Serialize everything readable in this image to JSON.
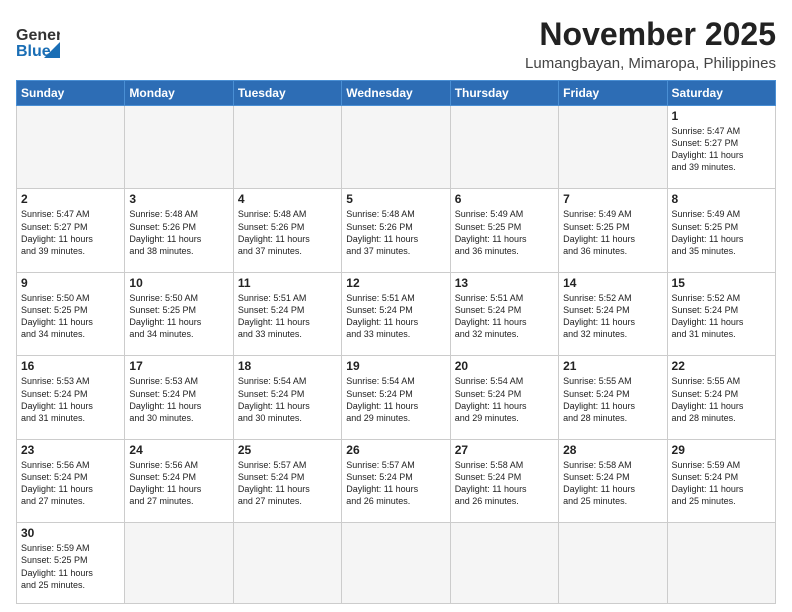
{
  "logo": {
    "text_general": "General",
    "text_blue": "Blue"
  },
  "header": {
    "month_title": "November 2025",
    "location": "Lumangbayan, Mimaropa, Philippines"
  },
  "weekdays": [
    "Sunday",
    "Monday",
    "Tuesday",
    "Wednesday",
    "Thursday",
    "Friday",
    "Saturday"
  ],
  "weeks": [
    [
      {
        "day": "",
        "info": ""
      },
      {
        "day": "",
        "info": ""
      },
      {
        "day": "",
        "info": ""
      },
      {
        "day": "",
        "info": ""
      },
      {
        "day": "",
        "info": ""
      },
      {
        "day": "",
        "info": ""
      },
      {
        "day": "1",
        "info": "Sunrise: 5:47 AM\nSunset: 5:27 PM\nDaylight: 11 hours\nand 39 minutes."
      }
    ],
    [
      {
        "day": "2",
        "info": "Sunrise: 5:47 AM\nSunset: 5:27 PM\nDaylight: 11 hours\nand 39 minutes."
      },
      {
        "day": "3",
        "info": "Sunrise: 5:48 AM\nSunset: 5:26 PM\nDaylight: 11 hours\nand 38 minutes."
      },
      {
        "day": "4",
        "info": "Sunrise: 5:48 AM\nSunset: 5:26 PM\nDaylight: 11 hours\nand 37 minutes."
      },
      {
        "day": "5",
        "info": "Sunrise: 5:48 AM\nSunset: 5:26 PM\nDaylight: 11 hours\nand 37 minutes."
      },
      {
        "day": "6",
        "info": "Sunrise: 5:49 AM\nSunset: 5:25 PM\nDaylight: 11 hours\nand 36 minutes."
      },
      {
        "day": "7",
        "info": "Sunrise: 5:49 AM\nSunset: 5:25 PM\nDaylight: 11 hours\nand 36 minutes."
      },
      {
        "day": "8",
        "info": "Sunrise: 5:49 AM\nSunset: 5:25 PM\nDaylight: 11 hours\nand 35 minutes."
      }
    ],
    [
      {
        "day": "9",
        "info": "Sunrise: 5:50 AM\nSunset: 5:25 PM\nDaylight: 11 hours\nand 34 minutes."
      },
      {
        "day": "10",
        "info": "Sunrise: 5:50 AM\nSunset: 5:25 PM\nDaylight: 11 hours\nand 34 minutes."
      },
      {
        "day": "11",
        "info": "Sunrise: 5:51 AM\nSunset: 5:24 PM\nDaylight: 11 hours\nand 33 minutes."
      },
      {
        "day": "12",
        "info": "Sunrise: 5:51 AM\nSunset: 5:24 PM\nDaylight: 11 hours\nand 33 minutes."
      },
      {
        "day": "13",
        "info": "Sunrise: 5:51 AM\nSunset: 5:24 PM\nDaylight: 11 hours\nand 32 minutes."
      },
      {
        "day": "14",
        "info": "Sunrise: 5:52 AM\nSunset: 5:24 PM\nDaylight: 11 hours\nand 32 minutes."
      },
      {
        "day": "15",
        "info": "Sunrise: 5:52 AM\nSunset: 5:24 PM\nDaylight: 11 hours\nand 31 minutes."
      }
    ],
    [
      {
        "day": "16",
        "info": "Sunrise: 5:53 AM\nSunset: 5:24 PM\nDaylight: 11 hours\nand 31 minutes."
      },
      {
        "day": "17",
        "info": "Sunrise: 5:53 AM\nSunset: 5:24 PM\nDaylight: 11 hours\nand 30 minutes."
      },
      {
        "day": "18",
        "info": "Sunrise: 5:54 AM\nSunset: 5:24 PM\nDaylight: 11 hours\nand 30 minutes."
      },
      {
        "day": "19",
        "info": "Sunrise: 5:54 AM\nSunset: 5:24 PM\nDaylight: 11 hours\nand 29 minutes."
      },
      {
        "day": "20",
        "info": "Sunrise: 5:54 AM\nSunset: 5:24 PM\nDaylight: 11 hours\nand 29 minutes."
      },
      {
        "day": "21",
        "info": "Sunrise: 5:55 AM\nSunset: 5:24 PM\nDaylight: 11 hours\nand 28 minutes."
      },
      {
        "day": "22",
        "info": "Sunrise: 5:55 AM\nSunset: 5:24 PM\nDaylight: 11 hours\nand 28 minutes."
      }
    ],
    [
      {
        "day": "23",
        "info": "Sunrise: 5:56 AM\nSunset: 5:24 PM\nDaylight: 11 hours\nand 27 minutes."
      },
      {
        "day": "24",
        "info": "Sunrise: 5:56 AM\nSunset: 5:24 PM\nDaylight: 11 hours\nand 27 minutes."
      },
      {
        "day": "25",
        "info": "Sunrise: 5:57 AM\nSunset: 5:24 PM\nDaylight: 11 hours\nand 27 minutes."
      },
      {
        "day": "26",
        "info": "Sunrise: 5:57 AM\nSunset: 5:24 PM\nDaylight: 11 hours\nand 26 minutes."
      },
      {
        "day": "27",
        "info": "Sunrise: 5:58 AM\nSunset: 5:24 PM\nDaylight: 11 hours\nand 26 minutes."
      },
      {
        "day": "28",
        "info": "Sunrise: 5:58 AM\nSunset: 5:24 PM\nDaylight: 11 hours\nand 25 minutes."
      },
      {
        "day": "29",
        "info": "Sunrise: 5:59 AM\nSunset: 5:24 PM\nDaylight: 11 hours\nand 25 minutes."
      }
    ],
    [
      {
        "day": "30",
        "info": "Sunrise: 5:59 AM\nSunset: 5:25 PM\nDaylight: 11 hours\nand 25 minutes."
      },
      {
        "day": "",
        "info": ""
      },
      {
        "day": "",
        "info": ""
      },
      {
        "day": "",
        "info": ""
      },
      {
        "day": "",
        "info": ""
      },
      {
        "day": "",
        "info": ""
      },
      {
        "day": "",
        "info": ""
      }
    ]
  ]
}
